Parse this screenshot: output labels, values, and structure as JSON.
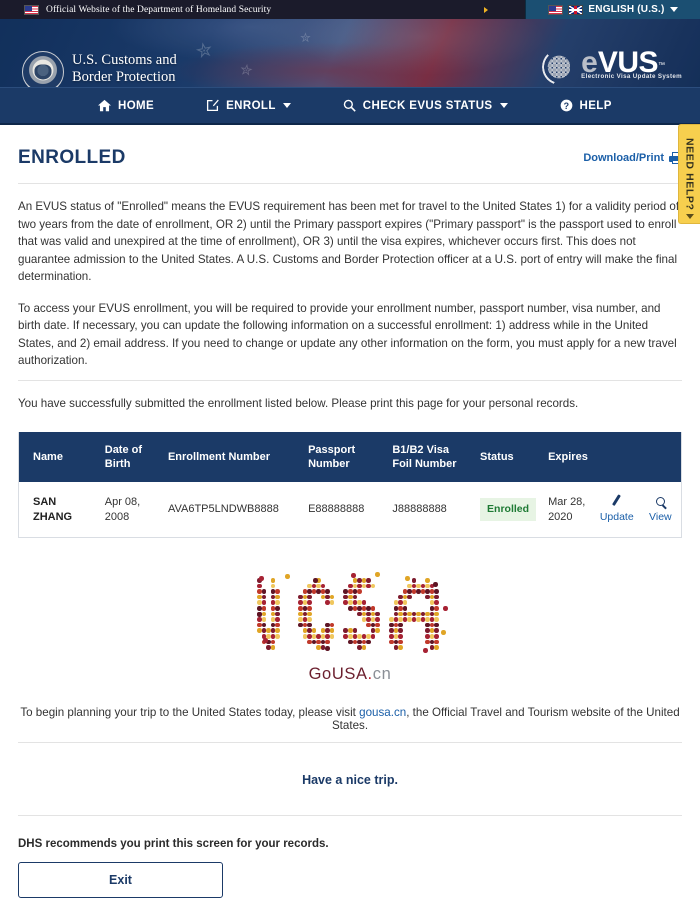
{
  "dhs_banner": {
    "text": "Official Website of the Department of Homeland Security",
    "flag_icon": "us-flag-icon",
    "language_selector": {
      "label": "ENGLISH (U.S.)",
      "us_flag_icon": "us-flag-icon",
      "uk_flag_icon": "uk-flag-icon",
      "caret_icon": "chevron-down-icon"
    }
  },
  "masthead": {
    "agency_line1": "U.S. Customs and",
    "agency_line2": "Border Protection",
    "seal_icon": "dhs-seal-icon",
    "logo": {
      "e": "e",
      "vus": "VUS",
      "tm": "™",
      "subtitle": "Electronic Visa Update System",
      "globe_icon": "globe-grid-icon"
    }
  },
  "nav": {
    "items": [
      {
        "label": "HOME",
        "icon": "home-icon",
        "has_caret": false
      },
      {
        "label": "ENROLL",
        "icon": "edit-square-icon",
        "has_caret": true
      },
      {
        "label": "CHECK EVUS STATUS",
        "icon": "search-icon",
        "has_caret": true
      },
      {
        "label": "HELP",
        "icon": "question-circle-icon",
        "has_caret": false
      }
    ]
  },
  "need_help_tab": {
    "label": "NEED HELP?",
    "caret_icon": "chevron-down-icon",
    "color": "#f7cf4e"
  },
  "page": {
    "title": "ENROLLED",
    "download_print": {
      "label": "Download/Print",
      "icon": "printer-icon"
    },
    "paragraphs": [
      "An EVUS status of \"Enrolled\" means the EVUS requirement has been met for travel to the United States 1) for a validity period of two years from the date of enrollment, OR 2) until the Primary passport expires (\"Primary passport\" is the passport used to enroll that was valid and unexpired at the time of enrollment), OR 3) until the visa expires, whichever occurs first. This does not guarantee admission to the United States. A U.S. Customs and Border Protection officer at a U.S. port of entry will make the final determination.",
      "To access your EVUS enrollment, you will be required to provide your enrollment number, passport number, visa number, and birth date. If necessary, you can update the following information on a successful enrollment: 1) address while in the United States, and 2) email address. If you need to change or update any other information on the form, you must apply for a new travel authorization.",
      "You have successfully submitted the enrollment listed below. Please print this page for your personal records."
    ]
  },
  "table": {
    "headers": [
      "Name",
      "Date of Birth",
      "Enrollment Number",
      "Passport Number",
      "B1/B2 Visa Foil Number",
      "Status",
      "Expires",
      "",
      ""
    ],
    "header_bg": "#1b3a67",
    "rows": [
      {
        "name": "SAN ZHANG",
        "date_of_birth": "Apr 08, 2008",
        "enrollment_number": "AVA6TP5LNDWB8888",
        "passport_number": "E88888888",
        "visa_foil_number": "J88888888",
        "status": "Enrolled",
        "status_color": "#1e7a34",
        "status_bg": "#e7f4e4",
        "expires": "Mar 28, 2020",
        "update_label": "Update",
        "update_icon": "pencil-icon",
        "view_label": "View",
        "view_icon": "magnifier-icon"
      }
    ]
  },
  "gousa": {
    "logo_alt": "USA dot-matrix logo",
    "wordmark_primary": "GoUSA",
    "wordmark_dot": ".",
    "wordmark_suffix": "cn",
    "dot_colors": [
      "#7d1b2e",
      "#a62233",
      "#c0392b",
      "#e0a526",
      "#f0c75e",
      "#5e1524"
    ],
    "note_before": "To begin planning your trip to the United States today, please visit ",
    "note_link": "gousa.cn",
    "note_after": ", the Official Travel and Tourism website of the United States."
  },
  "footer": {
    "nice_trip": "Have a nice trip.",
    "dhs_note": "DHS recommends you print this screen for your records.",
    "exit_label": "Exit"
  }
}
